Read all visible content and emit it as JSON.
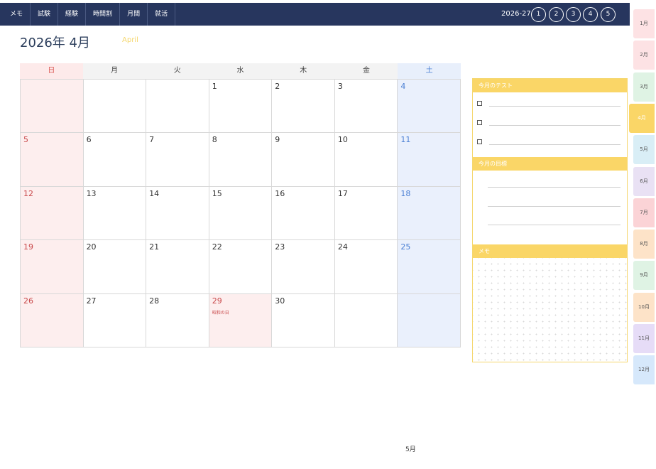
{
  "nav": {
    "items": [
      "メモ",
      "試験",
      "経験",
      "時間割",
      "月間",
      "就活"
    ],
    "year": "2026-27",
    "circles": [
      "1",
      "2",
      "3",
      "4",
      "5"
    ]
  },
  "header": {
    "title": "2026年 4月",
    "subtitle": "April"
  },
  "calendar": {
    "weekdays": [
      "日",
      "月",
      "火",
      "水",
      "木",
      "金",
      "土"
    ],
    "weeks": [
      [
        "",
        "",
        "",
        "1",
        "2",
        "3",
        "4"
      ],
      [
        "5",
        "6",
        "7",
        "8",
        "9",
        "10",
        "11"
      ],
      [
        "12",
        "13",
        "14",
        "15",
        "16",
        "17",
        "18"
      ],
      [
        "19",
        "20",
        "21",
        "22",
        "23",
        "24",
        "25"
      ],
      [
        "26",
        "27",
        "28",
        "29",
        "30",
        "",
        ""
      ]
    ],
    "holiday": {
      "day": "29",
      "name": "昭和の日"
    }
  },
  "side": {
    "test_title": "今月のテスト",
    "test_checkbox": "☐",
    "goal_title": "今月の目標",
    "memo_title": "メモ"
  },
  "month_tabs": [
    {
      "label": "1月",
      "color": "#fde2e4"
    },
    {
      "label": "2月",
      "color": "#fde2e4"
    },
    {
      "label": "3月",
      "color": "#dff3e4"
    },
    {
      "label": "4月",
      "color": "#fad667",
      "active": true
    },
    {
      "label": "5月",
      "color": "#d9eef6"
    },
    {
      "label": "6月",
      "color": "#e9e1f4"
    },
    {
      "label": "7月",
      "color": "#fbd3d6"
    },
    {
      "label": "8月",
      "color": "#fde3c8"
    },
    {
      "label": "9月",
      "color": "#dff3e4"
    },
    {
      "label": "10月",
      "color": "#fde3c8"
    },
    {
      "label": "11月",
      "color": "#e6dcf7"
    },
    {
      "label": "12月",
      "color": "#d6e8fb"
    }
  ],
  "footer": {
    "next_month": "5月"
  },
  "colors": {
    "nav_bg": "#27365e",
    "accent": "#fad667",
    "sunday": "#c9494b",
    "saturday": "#4a7fd4"
  }
}
